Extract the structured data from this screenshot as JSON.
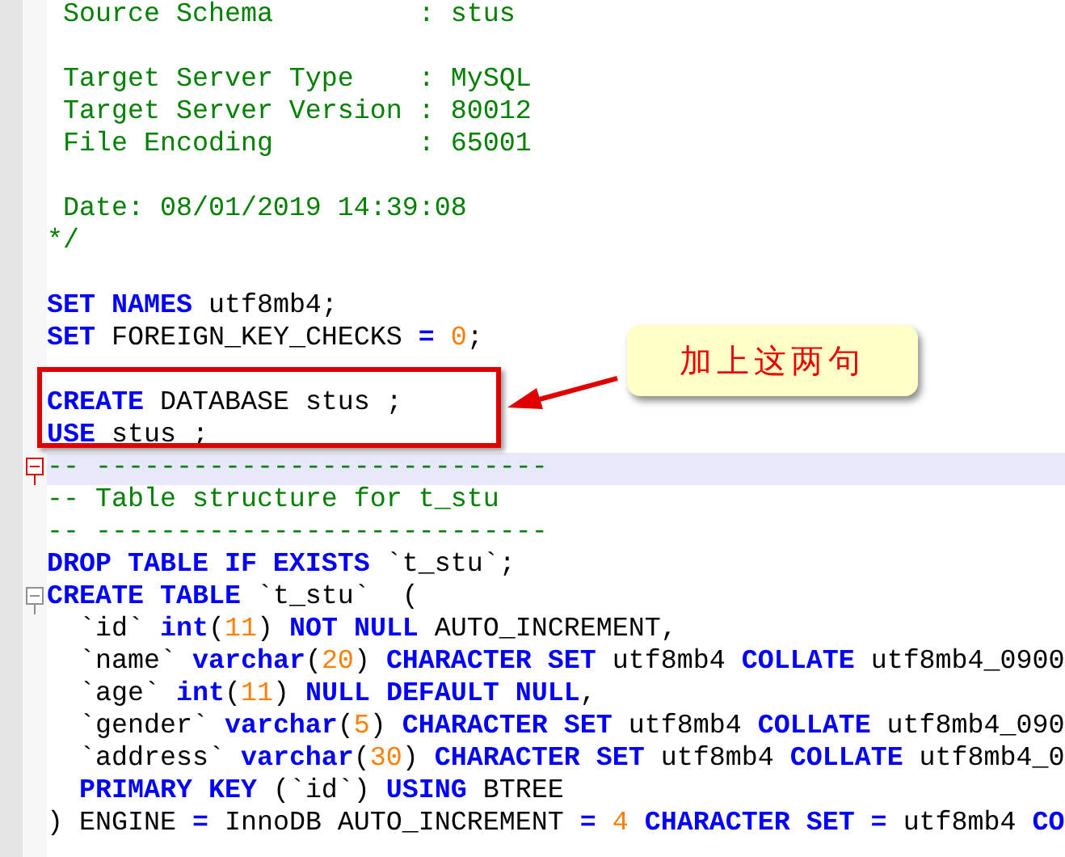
{
  "editor": {
    "lines": [
      {
        "current": false,
        "fold": false,
        "tokens": [
          {
            "kind": "comment",
            "text": " Source Schema         : stus"
          }
        ]
      },
      {
        "current": false,
        "fold": false
      },
      {
        "current": false,
        "fold": false,
        "tokens": [
          {
            "kind": "comment",
            "text": " Target Server Type    : MySQL"
          }
        ]
      },
      {
        "current": false,
        "fold": false,
        "tokens": [
          {
            "kind": "comment",
            "text": " Target Server Version : 80012"
          }
        ]
      },
      {
        "current": false,
        "fold": false,
        "tokens": [
          {
            "kind": "comment",
            "text": " File Encoding         : 65001"
          }
        ]
      },
      {
        "current": false,
        "fold": false
      },
      {
        "current": false,
        "fold": false,
        "tokens": [
          {
            "kind": "comment",
            "text": " Date: 08/01/2019 14:39:08"
          }
        ]
      },
      {
        "current": false,
        "fold": false,
        "tokens": [
          {
            "kind": "comment",
            "text": "*/"
          }
        ]
      },
      {
        "current": false,
        "fold": false
      },
      {
        "current": false,
        "fold": false,
        "tokens": [
          {
            "kind": "keyword",
            "text": "SET NAMES"
          },
          {
            "kind": "plain",
            "text": " utf8mb4;"
          }
        ]
      },
      {
        "current": false,
        "fold": false,
        "tokens": [
          {
            "kind": "keyword",
            "text": "SET"
          },
          {
            "kind": "plain",
            "text": " FOREIGN_KEY_CHECKS "
          },
          {
            "kind": "keyword",
            "text": "= "
          },
          {
            "kind": "number",
            "text": "0"
          },
          {
            "kind": "plain",
            "text": ";"
          }
        ]
      },
      {
        "current": false,
        "fold": false
      },
      {
        "current": false,
        "fold": false,
        "tokens": [
          {
            "kind": "keyword",
            "text": "CREATE"
          },
          {
            "kind": "plain",
            "text": " DATABASE stus ;"
          }
        ]
      },
      {
        "current": false,
        "fold": false,
        "tokens": [
          {
            "kind": "keyword",
            "text": "USE"
          },
          {
            "kind": "plain",
            "text": " stus ;"
          }
        ]
      },
      {
        "current": true,
        "fold": true,
        "tokens": [
          {
            "kind": "comment",
            "text": "-- ----------------------------"
          }
        ]
      },
      {
        "current": false,
        "fold": false,
        "tokens": [
          {
            "kind": "comment",
            "text": "-- Table structure for t_stu"
          }
        ]
      },
      {
        "current": false,
        "fold": false,
        "tokens": [
          {
            "kind": "comment",
            "text": "-- ----------------------------"
          }
        ]
      },
      {
        "current": false,
        "fold": false,
        "tokens": [
          {
            "kind": "keyword",
            "text": "DROP TABLE IF EXISTS"
          },
          {
            "kind": "plain",
            "text": " `t_stu`;"
          }
        ]
      },
      {
        "current": false,
        "fold": true,
        "tokens": [
          {
            "kind": "keyword",
            "text": "CREATE TABLE"
          },
          {
            "kind": "plain",
            "text": " `t_stu`  ("
          }
        ]
      },
      {
        "current": false,
        "fold": false,
        "tokens": [
          {
            "kind": "plain",
            "text": "  `id` "
          },
          {
            "kind": "keyword",
            "text": "int"
          },
          {
            "kind": "plain",
            "text": "("
          },
          {
            "kind": "number",
            "text": "11"
          },
          {
            "kind": "plain",
            "text": ") "
          },
          {
            "kind": "keyword",
            "text": "NOT NULL"
          },
          {
            "kind": "plain",
            "text": " AUTO_INCREMENT,"
          }
        ]
      },
      {
        "current": false,
        "fold": false,
        "tokens": [
          {
            "kind": "plain",
            "text": "  `name` "
          },
          {
            "kind": "keyword",
            "text": "varchar"
          },
          {
            "kind": "plain",
            "text": "("
          },
          {
            "kind": "number",
            "text": "20"
          },
          {
            "kind": "plain",
            "text": ") "
          },
          {
            "kind": "keyword",
            "text": "CHARACTER SET"
          },
          {
            "kind": "plain",
            "text": " utf8mb4 "
          },
          {
            "kind": "keyword",
            "text": "COLLATE"
          },
          {
            "kind": "plain",
            "text": " utf8mb4_0900"
          }
        ]
      },
      {
        "current": false,
        "fold": false,
        "tokens": [
          {
            "kind": "plain",
            "text": "  `age` "
          },
          {
            "kind": "keyword",
            "text": "int"
          },
          {
            "kind": "plain",
            "text": "("
          },
          {
            "kind": "number",
            "text": "11"
          },
          {
            "kind": "plain",
            "text": ") "
          },
          {
            "kind": "keyword",
            "text": "NULL DEFAULT NULL"
          },
          {
            "kind": "plain",
            "text": ","
          }
        ]
      },
      {
        "current": false,
        "fold": false,
        "tokens": [
          {
            "kind": "plain",
            "text": "  `gender` "
          },
          {
            "kind": "keyword",
            "text": "varchar"
          },
          {
            "kind": "plain",
            "text": "("
          },
          {
            "kind": "number",
            "text": "5"
          },
          {
            "kind": "plain",
            "text": ") "
          },
          {
            "kind": "keyword",
            "text": "CHARACTER SET"
          },
          {
            "kind": "plain",
            "text": " utf8mb4 "
          },
          {
            "kind": "keyword",
            "text": "COLLATE"
          },
          {
            "kind": "plain",
            "text": " utf8mb4_090"
          }
        ]
      },
      {
        "current": false,
        "fold": false,
        "tokens": [
          {
            "kind": "plain",
            "text": "  `address` "
          },
          {
            "kind": "keyword",
            "text": "varchar"
          },
          {
            "kind": "plain",
            "text": "("
          },
          {
            "kind": "number",
            "text": "30"
          },
          {
            "kind": "plain",
            "text": ") "
          },
          {
            "kind": "keyword",
            "text": "CHARACTER SET"
          },
          {
            "kind": "plain",
            "text": " utf8mb4 "
          },
          {
            "kind": "keyword",
            "text": "COLLATE"
          },
          {
            "kind": "plain",
            "text": " utf8mb4_0"
          }
        ]
      },
      {
        "current": false,
        "fold": false,
        "tokens": [
          {
            "kind": "keyword",
            "text": "  PRIMARY KEY"
          },
          {
            "kind": "plain",
            "text": " (`id`) "
          },
          {
            "kind": "keyword",
            "text": "USING"
          },
          {
            "kind": "plain",
            "text": " BTREE"
          }
        ]
      },
      {
        "current": false,
        "fold": false,
        "tokens": [
          {
            "kind": "plain",
            "text": ") ENGINE "
          },
          {
            "kind": "keyword",
            "text": "="
          },
          {
            "kind": "plain",
            "text": " InnoDB AUTO_INCREMENT "
          },
          {
            "kind": "keyword",
            "text": "= "
          },
          {
            "kind": "number",
            "text": "4 "
          },
          {
            "kind": "keyword",
            "text": "CHARACTER SET = "
          },
          {
            "kind": "plain",
            "text": "utf8mb4 "
          },
          {
            "kind": "keyword",
            "text": "CO"
          }
        ]
      }
    ]
  },
  "annotation": {
    "text": "加上这两句"
  }
}
